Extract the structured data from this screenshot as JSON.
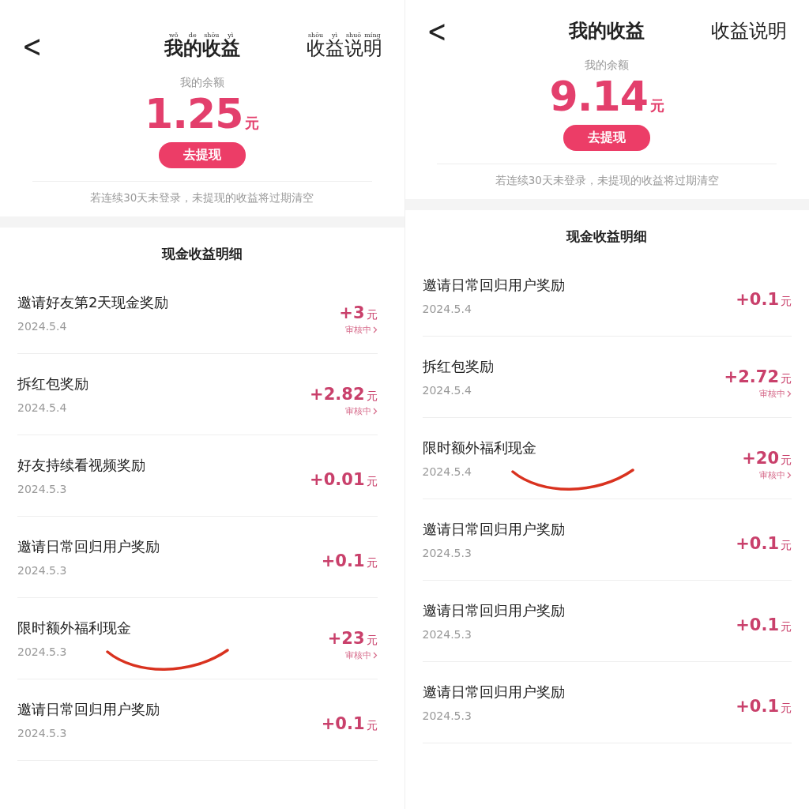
{
  "panels": [
    {
      "back": "<",
      "title": [
        {
          "char": "我",
          "pinyin": "wǒ"
        },
        {
          "char": "的",
          "pinyin": "de"
        },
        {
          "char": "收",
          "pinyin": "shōu"
        },
        {
          "char": "益",
          "pinyin": "yì"
        }
      ],
      "help": [
        {
          "char": "收",
          "pinyin": "shōu"
        },
        {
          "char": "益",
          "pinyin": "yì"
        },
        {
          "char": "说",
          "pinyin": "shuō"
        },
        {
          "char": "明",
          "pinyin": "míng"
        }
      ],
      "balance_label": "我的余额",
      "balance": "1.25",
      "unit": "元",
      "withdraw": "去提现",
      "notice": "若连续30天未登录，未提现的收益将过期清空",
      "section_title": "现金收益明细",
      "entries": [
        {
          "name": "邀请好友第2天现金奖励",
          "date": "2024.5.4",
          "amount": "+3",
          "unit": "元",
          "status": "审核中",
          "marked": false
        },
        {
          "name": "拆红包奖励",
          "date": "2024.5.4",
          "amount": "+2.82",
          "unit": "元",
          "status": "审核中",
          "marked": false
        },
        {
          "name": "好友持续看视频奖励",
          "date": "2024.5.3",
          "amount": "+0.01",
          "unit": "元",
          "marked": false
        },
        {
          "name": "邀请日常回归用户奖励",
          "date": "2024.5.3",
          "amount": "+0.1",
          "unit": "元",
          "marked": false
        },
        {
          "name": "限时额外福利现金",
          "date": "2024.5.3",
          "amount": "+23",
          "unit": "元",
          "status": "审核中",
          "marked": true
        },
        {
          "name": "邀请日常回归用户奖励",
          "date": "2024.5.3",
          "amount": "+0.1",
          "unit": "元",
          "marked": false
        }
      ]
    },
    {
      "back": "<",
      "title": [
        {
          "char": "我"
        },
        {
          "char": "的"
        },
        {
          "char": "收"
        },
        {
          "char": "益"
        }
      ],
      "help": [
        {
          "char": "收"
        },
        {
          "char": "益"
        },
        {
          "char": "说"
        },
        {
          "char": "明"
        }
      ],
      "balance_label": "我的余额",
      "balance": "9.14",
      "unit": "元",
      "withdraw": "去提现",
      "notice": "若连续30天未登录，未提现的收益将过期清空",
      "section_title": "现金收益明细",
      "entries": [
        {
          "name": "邀请日常回归用户奖励",
          "date": "2024.5.4",
          "amount": "+0.1",
          "unit": "元",
          "marked": false
        },
        {
          "name": "拆红包奖励",
          "date": "2024.5.4",
          "amount": "+2.72",
          "unit": "元",
          "status": "审核中",
          "marked": false
        },
        {
          "name": "限时额外福利现金",
          "date": "2024.5.4",
          "amount": "+20",
          "unit": "元",
          "status": "审核中",
          "marked": true
        },
        {
          "name": "邀请日常回归用户奖励",
          "date": "2024.5.3",
          "amount": "+0.1",
          "unit": "元",
          "marked": false
        },
        {
          "name": "邀请日常回归用户奖励",
          "date": "2024.5.3",
          "amount": "+0.1",
          "unit": "元",
          "marked": false
        },
        {
          "name": "邀请日常回归用户奖励",
          "date": "2024.5.3",
          "amount": "+0.1",
          "unit": "元",
          "marked": false
        }
      ]
    }
  ]
}
